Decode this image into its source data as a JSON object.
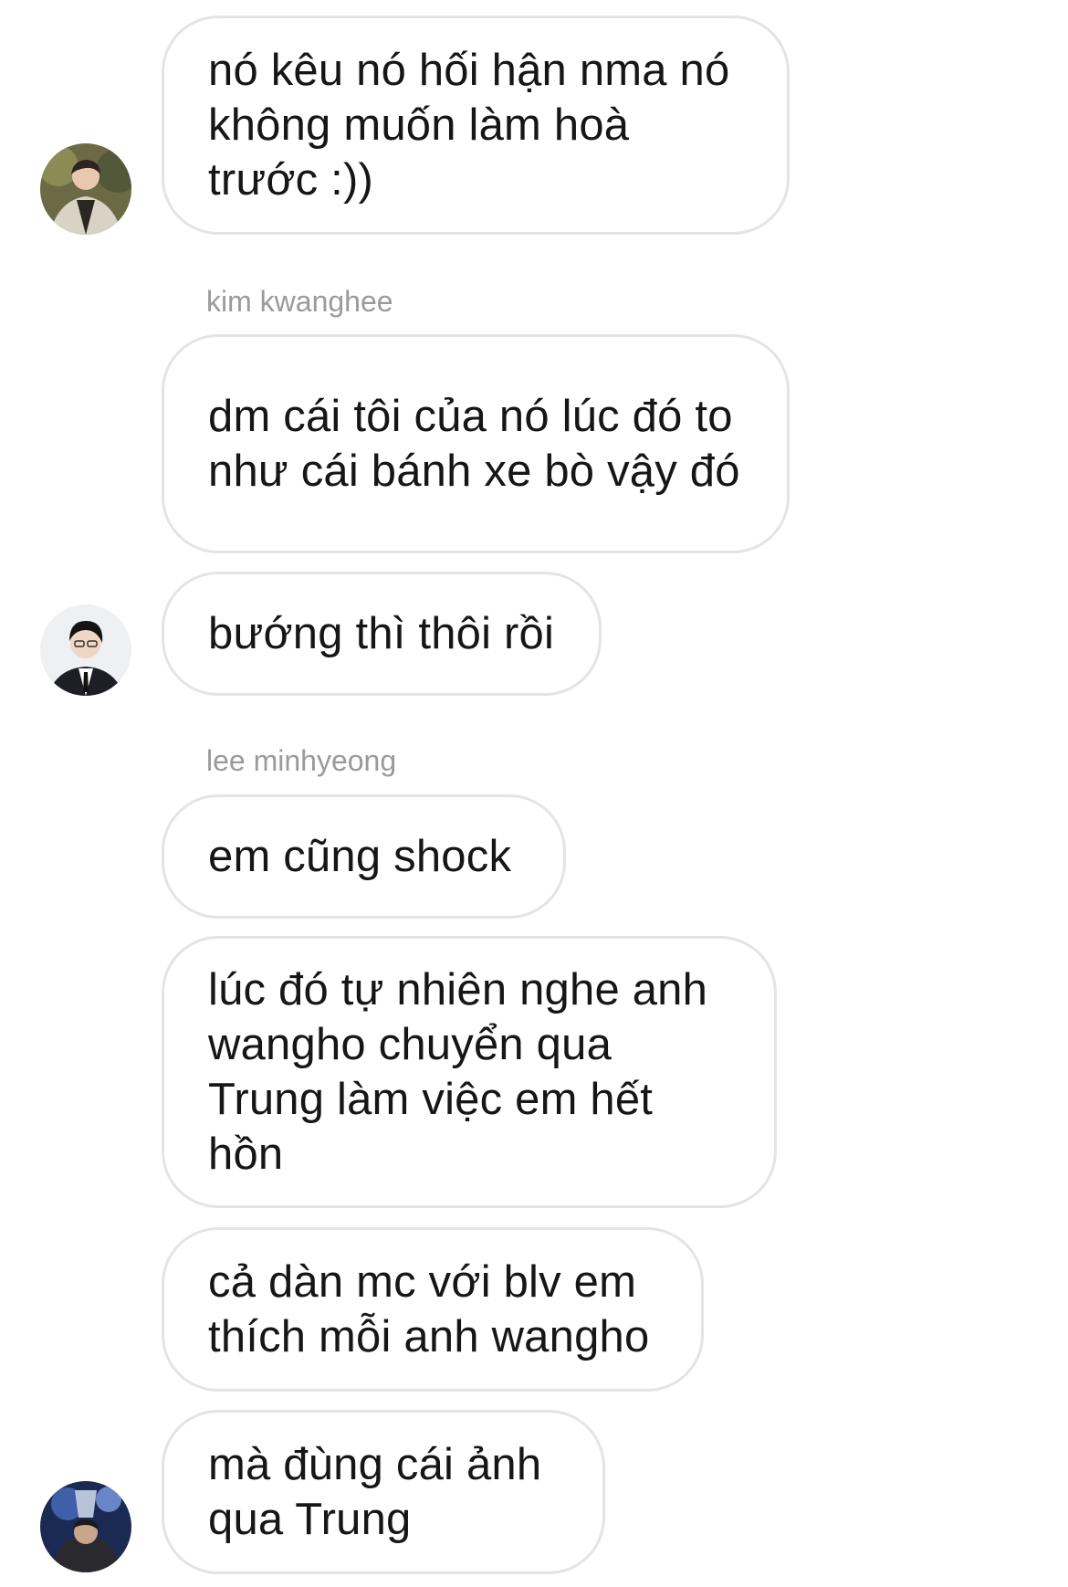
{
  "messages": [
    {
      "sender": "",
      "text": "nó kêu nó hối hận nma nó không muốn làm hoà trước :))",
      "avatar": "avatar-1"
    },
    {
      "sender": "kim kwanghee",
      "text": "dm cái tôi của nó lúc đó to như cái bánh xe bò vậy đó",
      "avatar": ""
    },
    {
      "sender": "",
      "text": "bướng thì thôi rồi",
      "avatar": "avatar-2"
    },
    {
      "sender": "lee minhyeong",
      "text": "em cũng shock",
      "avatar": ""
    },
    {
      "sender": "",
      "text": "lúc đó tự nhiên nghe anh wangho chuyển qua Trung làm việc em hết hồn",
      "avatar": ""
    },
    {
      "sender": "",
      "text": "cả dàn mc với blv em thích mỗi anh wangho",
      "avatar": ""
    },
    {
      "sender": "",
      "text": "mà đùng cái ảnh qua Trung",
      "avatar": "avatar-3"
    }
  ],
  "colors": {
    "bubble_border": "#e4e4e4",
    "text": "#161616",
    "sender": "#9a9a9a",
    "background": "#ffffff"
  }
}
